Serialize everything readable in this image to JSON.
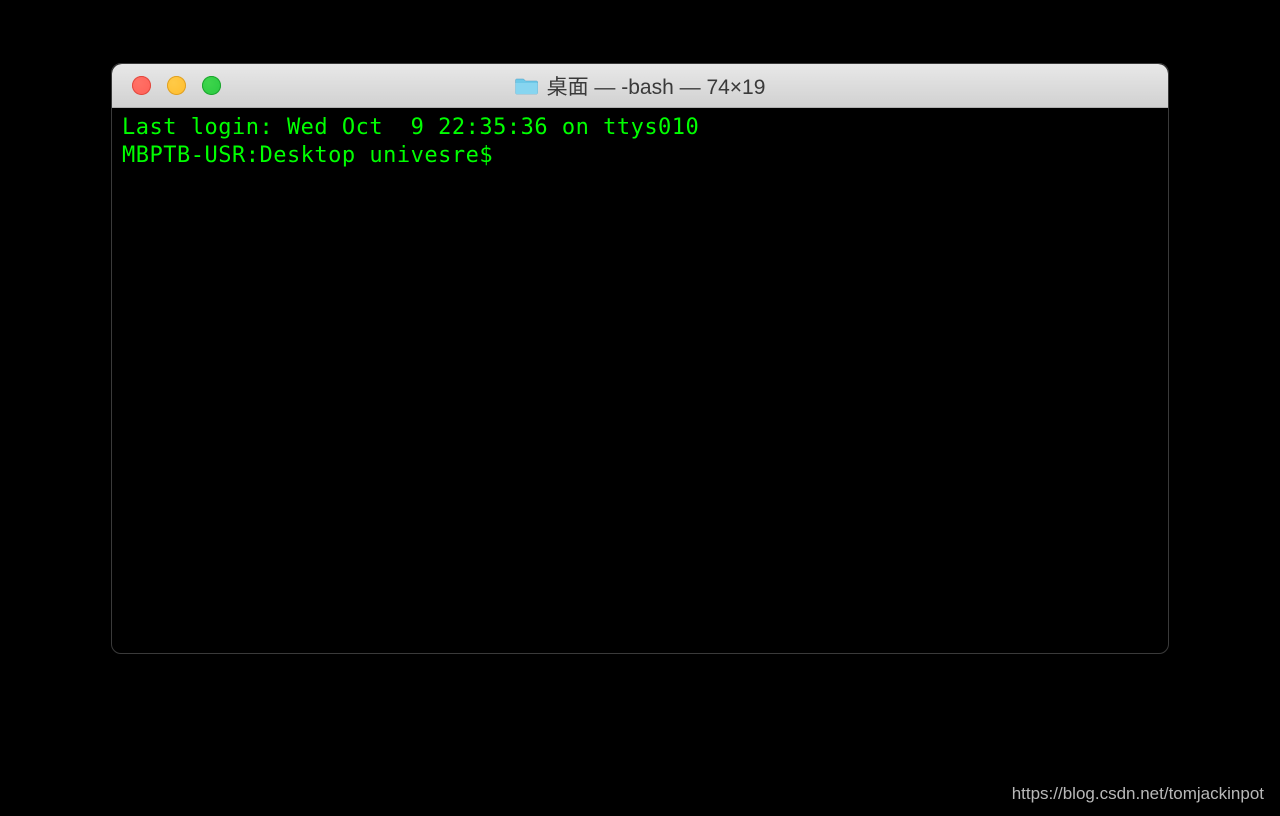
{
  "window": {
    "title": "桌面 — -bash — 74×19",
    "icon": "folder-icon"
  },
  "terminal": {
    "lines": [
      "Last login: Wed Oct  9 22:35:36 on ttys010",
      "MBPTB-USR:Desktop univesre$ "
    ],
    "text_color": "#00ff00",
    "background_color": "#000000"
  },
  "watermark": "https://blog.csdn.net/tomjackinpot"
}
